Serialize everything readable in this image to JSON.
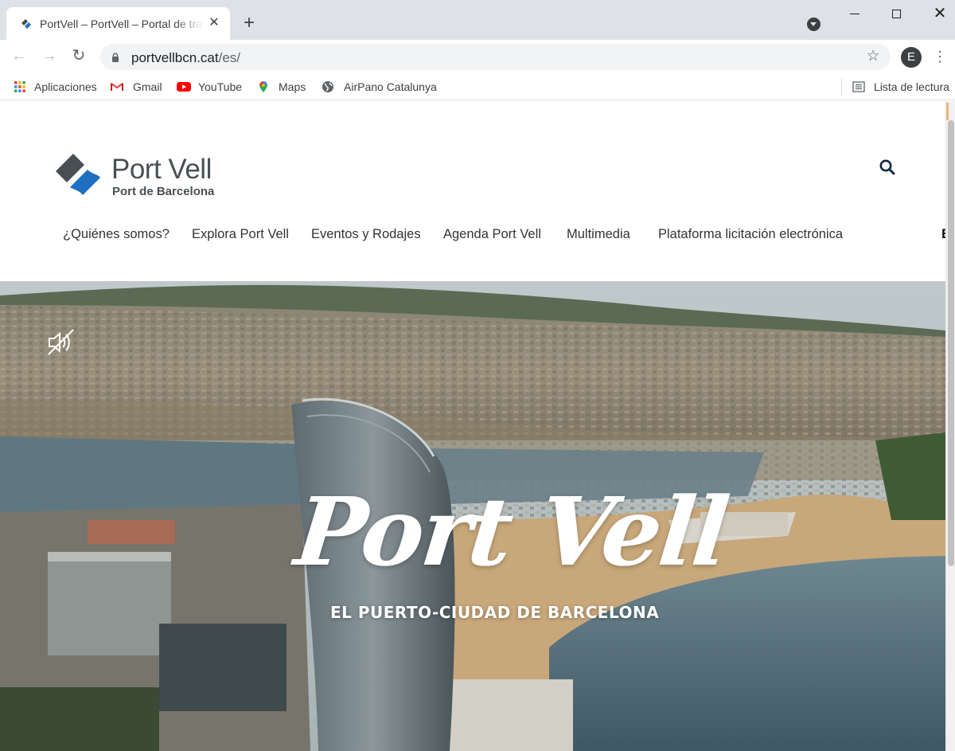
{
  "browser": {
    "tab": {
      "title": "PortVell – PortVell – Portal de transparencia",
      "close": "✕"
    },
    "new_tab": "+",
    "window": {
      "close": "✕"
    },
    "nav": {
      "back": "←",
      "forward": "→",
      "reload": "↻"
    },
    "address": {
      "host": "portvellbcn.cat",
      "path": "/es/"
    },
    "star": "☆",
    "profile_initial": "E",
    "menu": "⋮",
    "bookmarks": [
      {
        "label": "Aplicaciones",
        "icon": "apps-grid-icon"
      },
      {
        "label": "Gmail",
        "icon": "gmail-icon"
      },
      {
        "label": "YouTube",
        "icon": "youtube-icon"
      },
      {
        "label": "Maps",
        "icon": "maps-pin-icon"
      },
      {
        "label": "AirPano Catalunya",
        "icon": "globe-icon"
      }
    ],
    "reading_list": "Lista de lectura"
  },
  "site": {
    "logo": {
      "title": "Port Vell",
      "subtitle": "Port de Barcelona"
    },
    "nav": [
      "¿Quiénes somos?",
      "Explora Port Vell",
      "Eventos y Rodajes",
      "Agenda Port Vell",
      "Multimedia",
      "Plataforma licitación electrónica"
    ],
    "nav_overflow": "E",
    "hero": {
      "title": "Port Vell",
      "subtitle": "EL PUERTO-CIUDAD DE BARCELONA"
    }
  },
  "colors": {
    "tabstrip": "#dee1e6",
    "logo_blue": "#1e6fc2",
    "logo_gray": "#4a4f54",
    "sea": "#56707a",
    "sand": "#c8a77a"
  }
}
